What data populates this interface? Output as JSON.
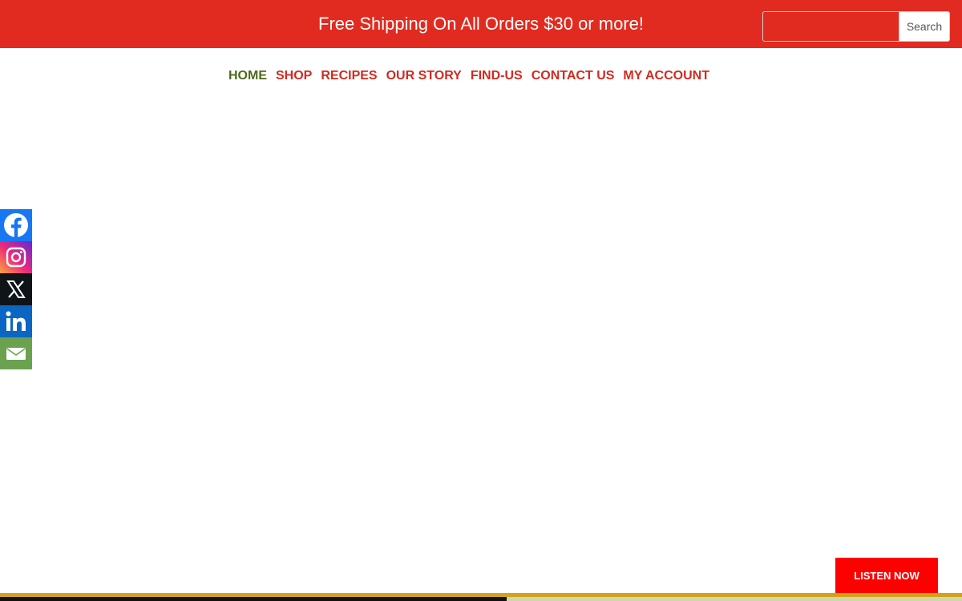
{
  "header": {
    "promo_text": "Free Shipping On All Orders $30 or more!",
    "search_input_value": "",
    "search_button_label": "Search"
  },
  "colors": {
    "topbar": "#e12b20",
    "nav_active": "#4e6a1b",
    "nav_default": "#d32a1f",
    "facebook": "#1877f2",
    "twitter_x": "#0f1419",
    "linkedin": "#0a66c2",
    "email": "#6aa24f",
    "listen_button": "#ff0000",
    "gold_line": "#d4a21a"
  },
  "nav": {
    "items": [
      {
        "label": "HOME",
        "active": true
      },
      {
        "label": "SHOP",
        "active": false
      },
      {
        "label": "RECIPES",
        "active": false
      },
      {
        "label": "OUR STORY",
        "active": false
      },
      {
        "label": "FIND-US",
        "active": false
      },
      {
        "label": "CONTACT US",
        "active": false
      },
      {
        "label": "MY ACCOUNT",
        "active": false
      }
    ]
  },
  "social": {
    "icons": [
      "facebook-icon",
      "instagram-icon",
      "x-twitter-icon",
      "linkedin-icon",
      "email-icon"
    ]
  },
  "listen": {
    "label": "LISTEN NOW"
  }
}
